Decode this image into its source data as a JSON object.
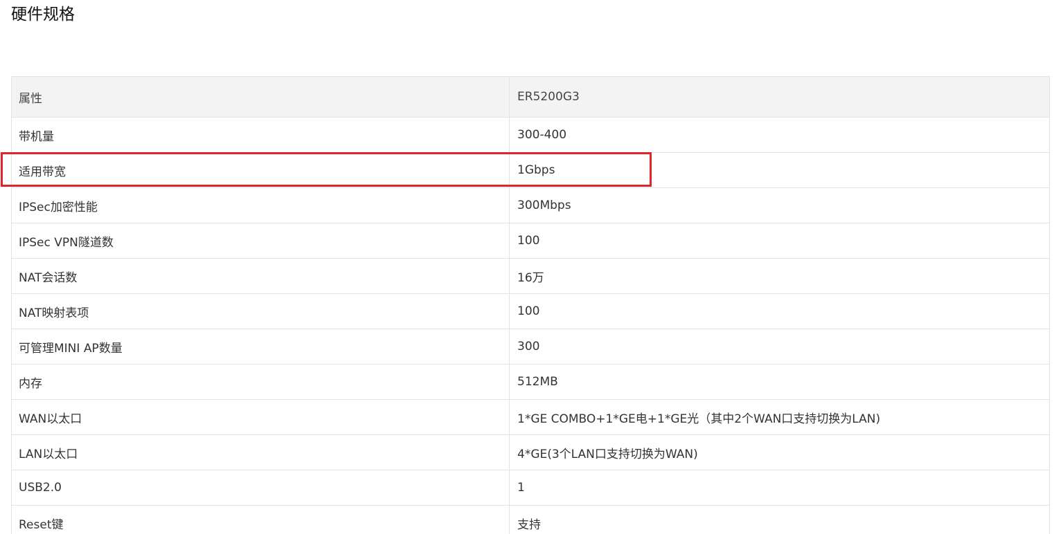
{
  "page": {
    "title": "硬件规格"
  },
  "table": {
    "header": {
      "attribute": "属性",
      "value": "ER5200G3"
    },
    "rows": [
      {
        "attribute": "带机量",
        "value": "300-400"
      },
      {
        "attribute": "适用带宽",
        "value": "1Gbps",
        "highlighted": true
      },
      {
        "attribute": "IPSec加密性能",
        "value": "300Mbps"
      },
      {
        "attribute": "IPSec VPN隧道数",
        "value": "100"
      },
      {
        "attribute": "NAT会话数",
        "value": "16万"
      },
      {
        "attribute": "NAT映射表项",
        "value": "100"
      },
      {
        "attribute": "可管理MINI AP数量",
        "value": "300"
      },
      {
        "attribute": "内存",
        "value": "512MB"
      },
      {
        "attribute": "WAN以太口",
        "value": "1*GE COMBO+1*GE电+1*GE光（其中2个WAN口支持切换为LAN)"
      },
      {
        "attribute": "LAN以太口",
        "value": "4*GE(3个LAN口支持切换为WAN)"
      },
      {
        "attribute": "USB2.0",
        "value": "1"
      },
      {
        "attribute": "Reset键",
        "value": "支持"
      }
    ]
  },
  "colors": {
    "highlight_border": "#e0242b",
    "header_background": "#f3f3f3",
    "grid_line": "#e3e3e3"
  }
}
